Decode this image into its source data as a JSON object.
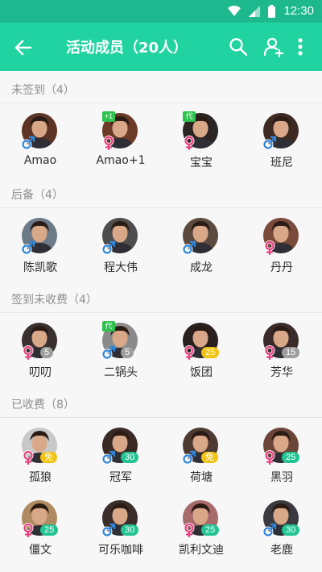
{
  "status_bar": {
    "time": "12:30",
    "icons": [
      "wifi-icon",
      "signal-icon",
      "battery-icon"
    ]
  },
  "app_bar": {
    "title": "活动成员（20人）",
    "icons": [
      "back-arrow-icon",
      "search-icon",
      "add-person-icon",
      "more-vert-icon"
    ]
  },
  "colors": {
    "accent": "#22d3a2",
    "status_bar": "#1eb88e",
    "male": "#2f86d9",
    "female": "#e63f7e",
    "badge_gray": "#9e9e9e",
    "badge_yellow": "#f2c312",
    "badge_teal": "#22c493",
    "tag_green": "#2ec24e"
  },
  "sections": [
    {
      "title": "未签到（4）",
      "members": [
        {
          "name": "Amao",
          "gender": "male",
          "tag": "",
          "badge": "",
          "badge_color": "",
          "avatar_color": "#5b3423"
        },
        {
          "name": "Amao+1",
          "gender": "female",
          "tag": "+1",
          "badge": "",
          "badge_color": "",
          "avatar_color": "#6b3b28"
        },
        {
          "name": "宝宝",
          "gender": "female",
          "tag": "代",
          "badge": "",
          "badge_color": "",
          "avatar_color": "#2a2423"
        },
        {
          "name": "班尼",
          "gender": "male",
          "tag": "",
          "badge": "",
          "badge_color": "",
          "avatar_color": "#3d2a22"
        }
      ]
    },
    {
      "title": "后备（4）",
      "members": [
        {
          "name": "陈凯歌",
          "gender": "male",
          "tag": "",
          "badge": "",
          "badge_color": "",
          "avatar_color": "#6d7a88"
        },
        {
          "name": "程大伟",
          "gender": "male",
          "tag": "",
          "badge": "",
          "badge_color": "",
          "avatar_color": "#4d4d4d"
        },
        {
          "name": "成龙",
          "gender": "male",
          "tag": "",
          "badge": "",
          "badge_color": "",
          "avatar_color": "#5c4a3f"
        },
        {
          "name": "丹丹",
          "gender": "female",
          "tag": "",
          "badge": "",
          "badge_color": "",
          "avatar_color": "#7a4a3a"
        }
      ]
    },
    {
      "title": "签到未收费（4）",
      "members": [
        {
          "name": "叨叨",
          "gender": "female",
          "tag": "",
          "badge": "5",
          "badge_color": "#9e9e9e",
          "avatar_color": "#3a3030"
        },
        {
          "name": "二锅头",
          "gender": "male",
          "tag": "代",
          "badge": "5",
          "badge_color": "#9e9e9e",
          "avatar_color": "#8a8a8a"
        },
        {
          "name": "饭团",
          "gender": "female",
          "tag": "",
          "badge": "25",
          "badge_color": "#f2c312",
          "avatar_color": "#2a2020"
        },
        {
          "name": "芳华",
          "gender": "female",
          "tag": "",
          "badge": "15",
          "badge_color": "#9e9e9e",
          "avatar_color": "#3b2b2b"
        }
      ]
    },
    {
      "title": "已收费（8）",
      "members": [
        {
          "name": "孤狼",
          "gender": "female",
          "tag": "",
          "badge": "免",
          "badge_color": "#f2c312",
          "avatar_color": "#c8c8c8"
        },
        {
          "name": "冠军",
          "gender": "male",
          "tag": "",
          "badge": "30",
          "badge_color": "#22c493",
          "avatar_color": "#3b2a24"
        },
        {
          "name": "荷塘",
          "gender": "male",
          "tag": "",
          "badge": "免",
          "badge_color": "#f2c312",
          "avatar_color": "#4d3a30"
        },
        {
          "name": "黑羽",
          "gender": "female",
          "tag": "",
          "badge": "25",
          "badge_color": "#22c493",
          "avatar_color": "#6b4538"
        },
        {
          "name": "僵文",
          "gender": "female",
          "tag": "",
          "badge": "25",
          "badge_color": "#22c493",
          "avatar_color": "#b08a60"
        },
        {
          "name": "可乐咖啡",
          "gender": "male",
          "tag": "",
          "badge": "30",
          "badge_color": "#22c493",
          "avatar_color": "#3b2e2a"
        },
        {
          "name": "凯利文迪",
          "gender": "female",
          "tag": "",
          "badge": "25",
          "badge_color": "#22c493",
          "avatar_color": "#a86a6a"
        },
        {
          "name": "老鹿",
          "gender": "male",
          "tag": "",
          "badge": "30",
          "badge_color": "#22c493",
          "avatar_color": "#3a3a40"
        }
      ]
    }
  ]
}
